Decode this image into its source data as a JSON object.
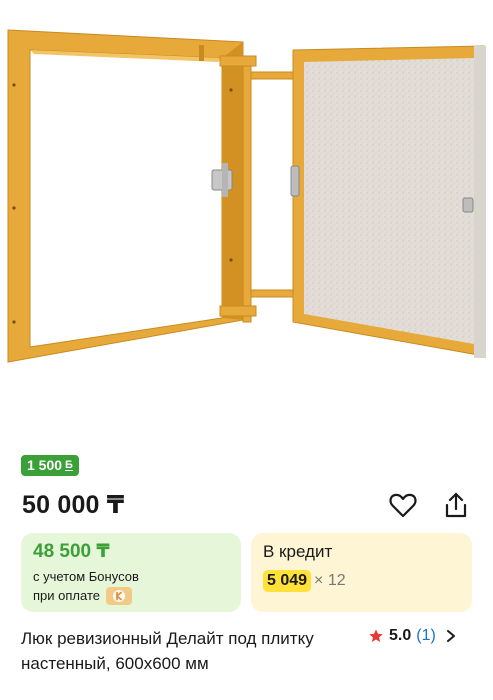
{
  "product": {
    "image_alt": "Люк ревизионный Делайт под плитку настенный, 600x600 мм",
    "title": "Люк ревизионный Делайт под плитку настенный, 600x600 мм"
  },
  "bonus_badge": {
    "value": "1 500",
    "icon": "Б"
  },
  "price": {
    "main": "50 000 ₸"
  },
  "actions": {
    "favorite_icon": "heart-icon",
    "share_icon": "share-icon"
  },
  "bonus_price": {
    "value": "48 500 ₸",
    "line1": "с учетом Бонусов",
    "line2": "при оплате"
  },
  "credit": {
    "label": "В кредит",
    "amount": "5 049",
    "term": "× 12"
  },
  "rating": {
    "score": "5.0",
    "count": "(1)"
  },
  "colors": {
    "green": "#3aa037",
    "green_bg": "#e6f6d8",
    "credit_bg": "#fdf5d3",
    "credit_highlight": "#ffe13a",
    "star": "#e53935",
    "link": "#1a73c9",
    "frame": "#e6a93a"
  }
}
